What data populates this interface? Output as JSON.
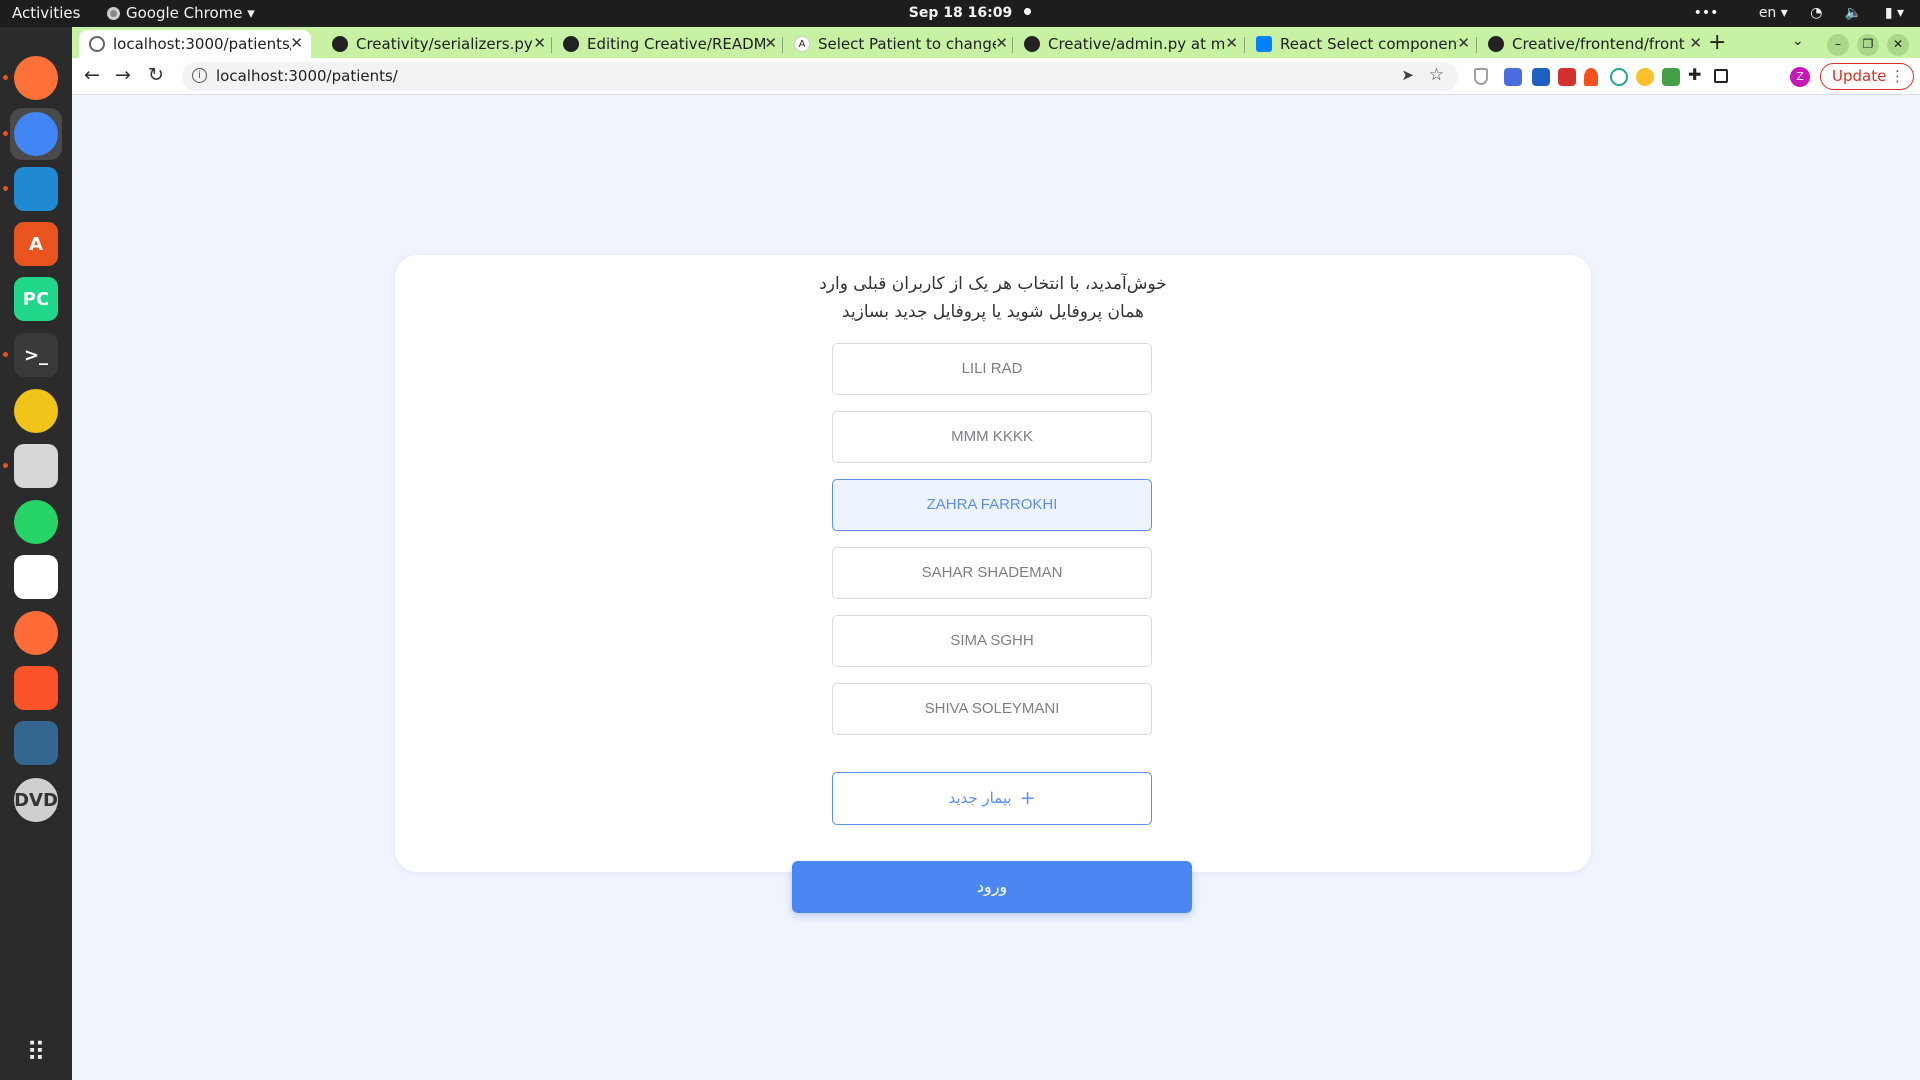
{
  "topbar": {
    "activities": "Activities",
    "app_name": "Google Chrome",
    "clock": "Sep 18  16:09",
    "lang": "en"
  },
  "dock": [
    {
      "name": "firefox-icon",
      "glyph": "",
      "color": "#ff7139"
    },
    {
      "name": "chrome-icon",
      "glyph": "",
      "color": "#4285f4"
    },
    {
      "name": "vscode-icon",
      "glyph": "",
      "color": "#1f8ad2"
    },
    {
      "name": "software-center-icon",
      "glyph": "A",
      "color": "#e95420"
    },
    {
      "name": "pycharm-icon",
      "glyph": "PC",
      "color": "#21d789"
    },
    {
      "name": "terminal-icon",
      "glyph": ">_",
      "color": "#3a3a3a"
    },
    {
      "name": "rhythmbox-icon",
      "glyph": "",
      "color": "#f0c419"
    },
    {
      "name": "files-icon",
      "glyph": "",
      "color": "#d7d7d7"
    },
    {
      "name": "whatsapp-icon",
      "glyph": "",
      "color": "#25d366"
    },
    {
      "name": "text-editor-icon",
      "glyph": "",
      "color": "#ffffff"
    },
    {
      "name": "postman-icon",
      "glyph": "",
      "color": "#ff6c37"
    },
    {
      "name": "brave-icon",
      "glyph": "",
      "color": "#fb542b"
    },
    {
      "name": "pgadmin-icon",
      "glyph": "",
      "color": "#336791"
    },
    {
      "name": "dvd-icon",
      "glyph": "DVD",
      "color": "#cfcfcf"
    }
  ],
  "tabs": [
    {
      "title": "localhost:3000/patients/",
      "active": true,
      "favicon": "globe-icon"
    },
    {
      "title": "Creativity/serializers.py",
      "active": false,
      "favicon": "github-icon"
    },
    {
      "title": "Editing Creative/README",
      "active": false,
      "favicon": "github-icon"
    },
    {
      "title": "Select Patient to change",
      "active": false,
      "favicon": "django-icon"
    },
    {
      "title": "Creative/admin.py at ma",
      "active": false,
      "favicon": "github-icon"
    },
    {
      "title": "React Select component",
      "active": false,
      "favicon": "mui-icon"
    },
    {
      "title": "Creative/frontend/front",
      "active": false,
      "favicon": "github-icon"
    }
  ],
  "toolbar": {
    "url": "localhost:3000/patients/",
    "update_label": "Update",
    "profile_initial": "Z"
  },
  "page": {
    "welcome_line1": "خوش‌آمدید، با انتخاب هر یک از کاربران قبلی وارد",
    "welcome_line2": "همان پروفایل شوید یا پروفایل جدید بسازید",
    "patients": [
      {
        "name": "LILI RAD",
        "selected": false
      },
      {
        "name": "MMM KKKK",
        "selected": false
      },
      {
        "name": "ZAHRA FARROKHI",
        "selected": true
      },
      {
        "name": "SAHAR SHADEMAN",
        "selected": false
      },
      {
        "name": "SIMA SGHH",
        "selected": false
      },
      {
        "name": "SHIVA SOLEYMANI",
        "selected": false
      }
    ],
    "new_patient_label": "بیمار جدید",
    "login_label": "ورود"
  }
}
